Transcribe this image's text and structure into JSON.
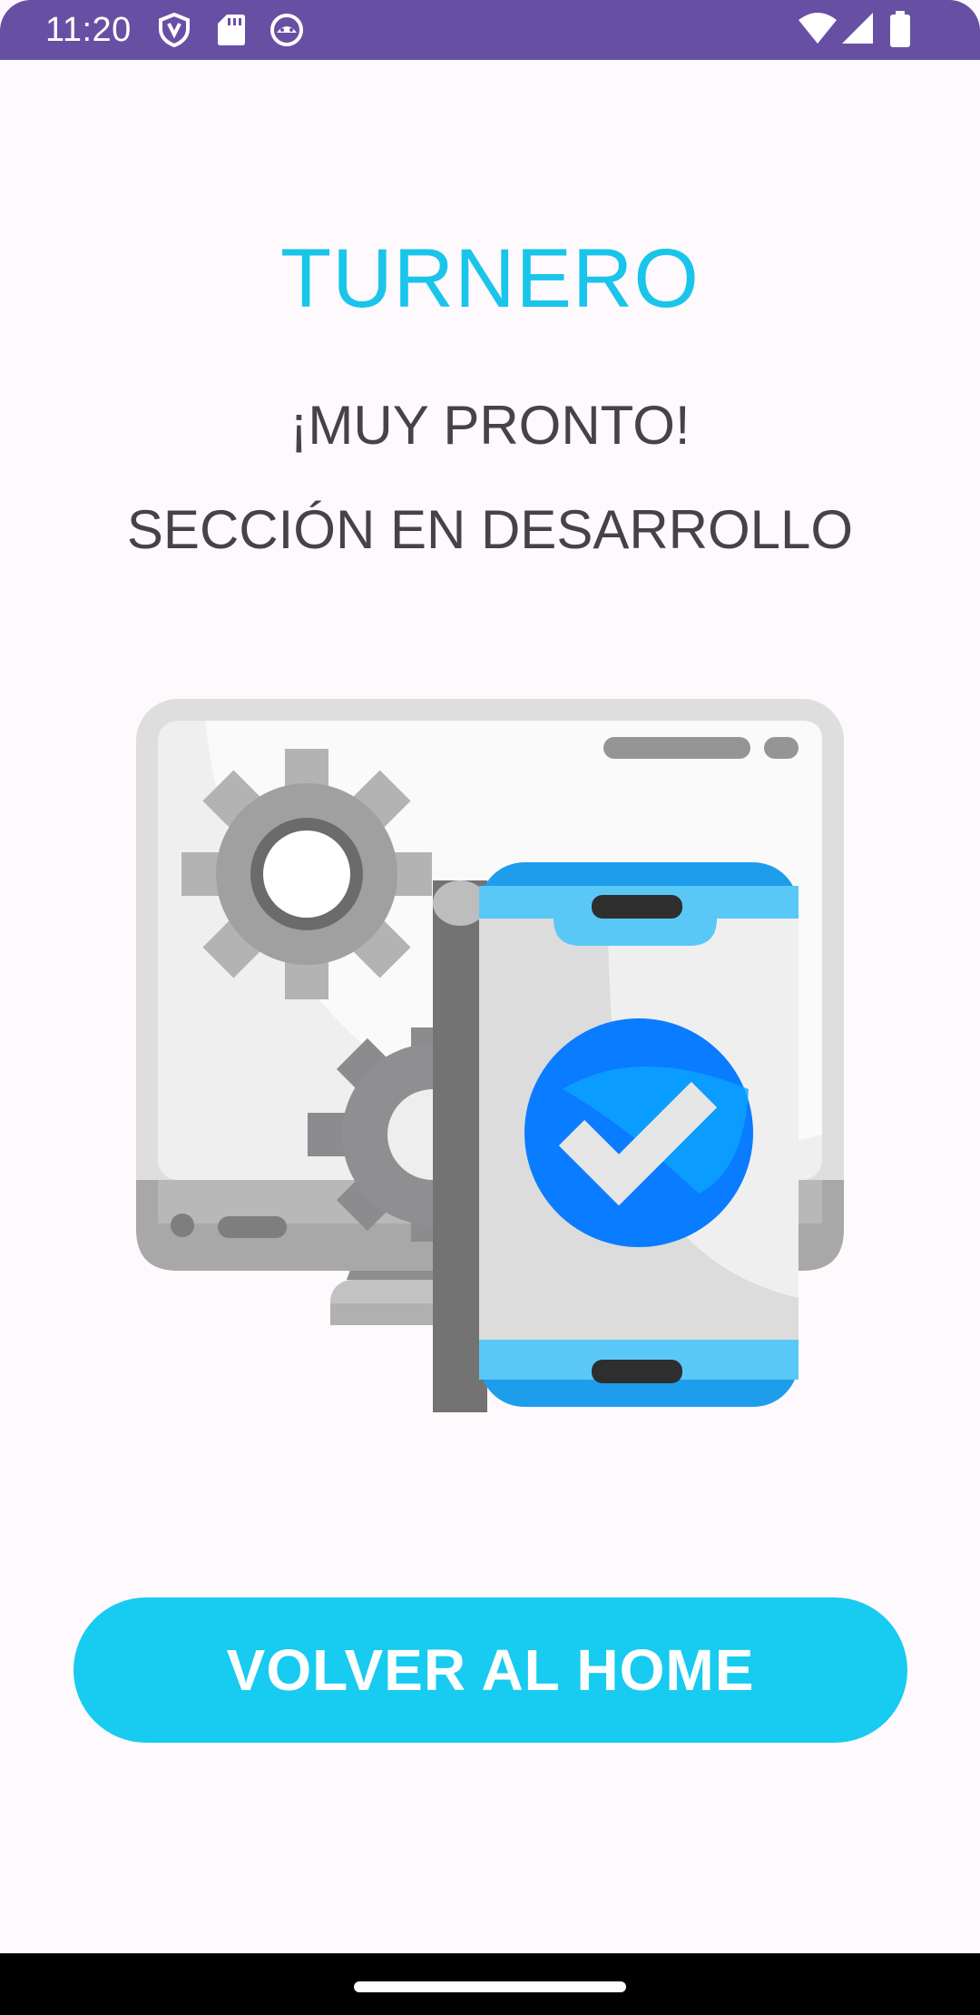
{
  "status_bar": {
    "time": "11:20",
    "left_icons": [
      "shield-icon",
      "sd-card-icon",
      "android-face-icon"
    ],
    "right_icons": [
      "wifi-icon",
      "cell-signal-icon",
      "battery-icon"
    ],
    "color": "#6750a4"
  },
  "screen": {
    "title": "TURNERO",
    "subtitle_1": "¡MUY PRONTO!",
    "subtitle_2": "SECCIÓN EN DESARROLLO",
    "illustration": "monitor-phone-gears-checkmark-illustration",
    "home_button_label": "VOLVER AL HOME"
  },
  "colors": {
    "accent": "#19c5ea",
    "button": "#18cbf0",
    "text": "#45434a",
    "background": "#fef9fc"
  }
}
